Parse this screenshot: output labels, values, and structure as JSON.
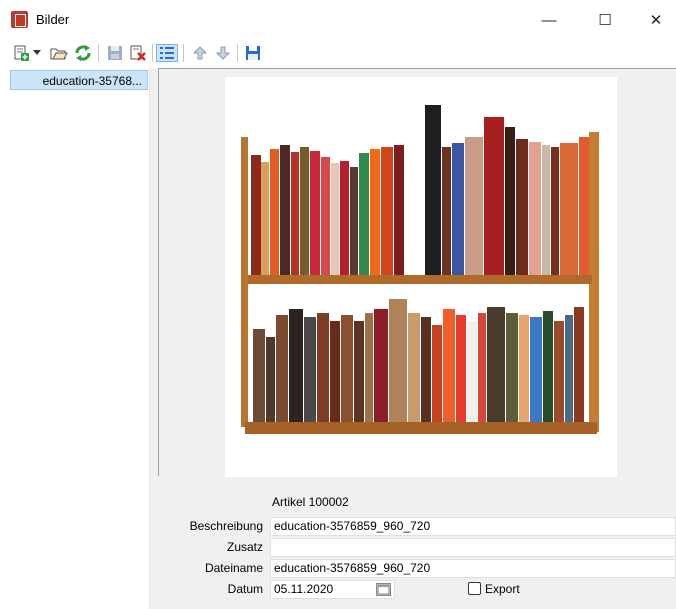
{
  "window": {
    "title": "Bilder",
    "controls": {
      "minimize": "—",
      "maximize": "☐",
      "close": "✕"
    }
  },
  "toolbar": {
    "icons": [
      "add-icon",
      "dropdown-arrow-icon",
      "open-folder-icon",
      "refresh-icon",
      "save-icon",
      "delete-icon",
      "details-list-icon",
      "arrow-up-icon",
      "arrow-down-icon",
      "save-file-icon"
    ]
  },
  "list": {
    "items": [
      {
        "label": "education-35768..."
      }
    ]
  },
  "image": {
    "alt": "Bookshelf"
  },
  "form": {
    "artikel": "Artikel 100002",
    "beschreibung_label": "Beschreibung",
    "beschreibung_value": "education-3576859_960_720",
    "zusatz_label": "Zusatz",
    "zusatz_value": "",
    "dateiname_label": "Dateiname",
    "dateiname_value": "education-3576859_960_720",
    "datum_label": "Datum",
    "datum_value": "05.11.2020",
    "export_label": "Export",
    "export_checked": false
  }
}
